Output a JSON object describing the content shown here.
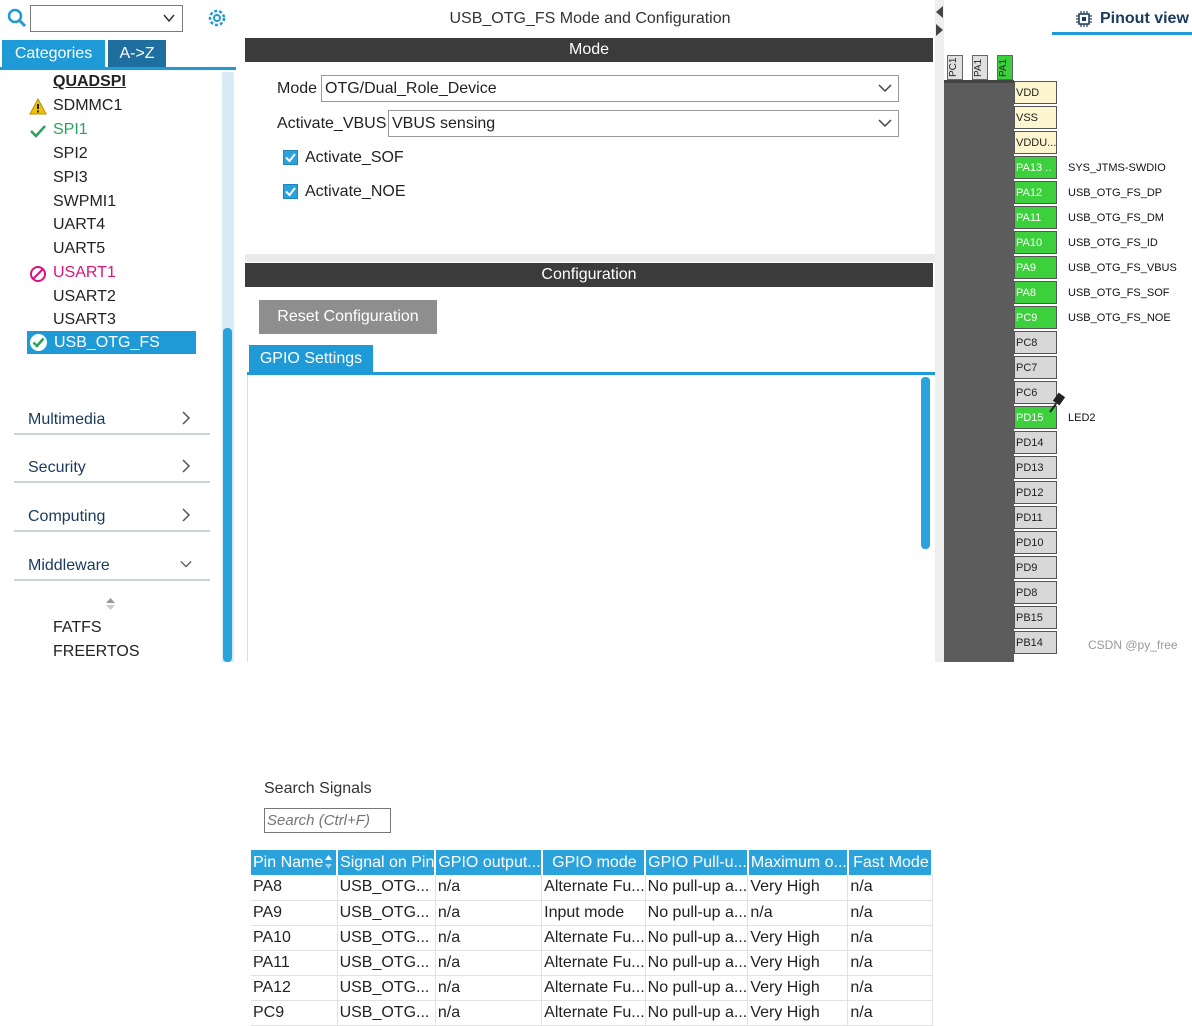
{
  "left": {
    "categories_tab": "Categories",
    "az_tab": "A->Z",
    "peripherals": [
      {
        "label": "QUADSPI",
        "status": "none",
        "bold": true
      },
      {
        "label": "SDMMC1",
        "status": "warning"
      },
      {
        "label": "SPI1",
        "status": "ok"
      },
      {
        "label": "SPI2",
        "status": "none"
      },
      {
        "label": "SPI3",
        "status": "none"
      },
      {
        "label": "SWPMI1",
        "status": "none"
      },
      {
        "label": "UART4",
        "status": "none"
      },
      {
        "label": "UART5",
        "status": "none"
      },
      {
        "label": "USART1",
        "status": "disabled"
      },
      {
        "label": "USART2",
        "status": "none"
      },
      {
        "label": "USART3",
        "status": "none"
      },
      {
        "label": "USB_OTG_FS",
        "status": "selected"
      }
    ],
    "sections": [
      {
        "label": "Multimedia",
        "expanded": false
      },
      {
        "label": "Security",
        "expanded": false
      },
      {
        "label": "Computing",
        "expanded": false
      },
      {
        "label": "Middleware",
        "expanded": true
      }
    ],
    "middleware_items": [
      "FATFS",
      "FREERTOS"
    ]
  },
  "middle": {
    "title": "USB_OTG_FS Mode and Configuration",
    "mode_header": "Mode",
    "mode_label": "Mode",
    "mode_value": "OTG/Dual_Role_Device",
    "vbus_label": "Activate_VBUS",
    "vbus_value": "VBUS sensing",
    "sof_label": "Activate_SOF",
    "sof_checked": true,
    "noe_label": "Activate_NOE",
    "noe_checked": true,
    "config_header": "Configuration",
    "reset_button": "Reset Configuration",
    "gpio_tab": "GPIO Settings",
    "search_signals_label": "Search Signals",
    "search_placeholder": "Search (Ctrl+F)",
    "table": {
      "headers": [
        "Pin Name",
        "Signal on Pin",
        "GPIO output...",
        "GPIO mode",
        "GPIO Pull-u...",
        "Maximum o...",
        "Fast Mode"
      ],
      "rows": [
        [
          "PA8",
          "USB_OTG...",
          "n/a",
          "Alternate Fu...",
          "No pull-up a...",
          "Very High",
          "n/a"
        ],
        [
          "PA9",
          "USB_OTG...",
          "n/a",
          "Input mode",
          "No pull-up a...",
          "n/a",
          "n/a"
        ],
        [
          "PA10",
          "USB_OTG...",
          "n/a",
          "Alternate Fu...",
          "No pull-up a...",
          "Very High",
          "n/a"
        ],
        [
          "PA11",
          "USB_OTG...",
          "n/a",
          "Alternate Fu...",
          "No pull-up a...",
          "Very High",
          "n/a"
        ],
        [
          "PA12",
          "USB_OTG...",
          "n/a",
          "Alternate Fu...",
          "No pull-up a...",
          "Very High",
          "n/a"
        ],
        [
          "PC9",
          "USB_OTG...",
          "n/a",
          "Alternate Fu...",
          "No pull-up a...",
          "Very High",
          "n/a"
        ]
      ]
    }
  },
  "right": {
    "title": "Pinout view",
    "top_pins": [
      "PC1",
      "PA1",
      "PA1"
    ],
    "pins": [
      {
        "name": "VDD",
        "color": "yellow",
        "label": ""
      },
      {
        "name": "VSS",
        "color": "yellow",
        "label": ""
      },
      {
        "name": "VDDU...",
        "color": "yellow",
        "label": ""
      },
      {
        "name": "PA13 ..",
        "color": "green",
        "label": "SYS_JTMS-SWDIO"
      },
      {
        "name": "PA12",
        "color": "green",
        "label": "USB_OTG_FS_DP"
      },
      {
        "name": "PA11",
        "color": "green",
        "label": "USB_OTG_FS_DM"
      },
      {
        "name": "PA10",
        "color": "green",
        "label": "USB_OTG_FS_ID"
      },
      {
        "name": "PA9",
        "color": "green",
        "label": "USB_OTG_FS_VBUS"
      },
      {
        "name": "PA8",
        "color": "green",
        "label": "USB_OTG_FS_SOF"
      },
      {
        "name": "PC9",
        "color": "green",
        "label": "USB_OTG_FS_NOE"
      },
      {
        "name": "PC8",
        "color": "grey",
        "label": ""
      },
      {
        "name": "PC7",
        "color": "grey",
        "label": ""
      },
      {
        "name": "PC6",
        "color": "grey",
        "label": ""
      },
      {
        "name": "PD15",
        "color": "green",
        "label": "LED2"
      },
      {
        "name": "PD14",
        "color": "grey",
        "label": ""
      },
      {
        "name": "PD13",
        "color": "grey",
        "label": ""
      },
      {
        "name": "PD12",
        "color": "grey",
        "label": ""
      },
      {
        "name": "PD11",
        "color": "grey",
        "label": ""
      },
      {
        "name": "PD10",
        "color": "grey",
        "label": ""
      },
      {
        "name": "PD9",
        "color": "grey",
        "label": ""
      },
      {
        "name": "PD8",
        "color": "grey",
        "label": ""
      },
      {
        "name": "PB15",
        "color": "grey",
        "label": ""
      },
      {
        "name": "PB14",
        "color": "grey",
        "label": ""
      }
    ]
  },
  "watermark": "CSDN @py_free",
  "colors": {
    "accent": "#1e9ad6",
    "pin_green": "#3cd13c",
    "pin_yellow": "#fdf6cf",
    "ok": "#2aa35a",
    "disabled": "#d6157b",
    "warning": "#f2c200"
  }
}
